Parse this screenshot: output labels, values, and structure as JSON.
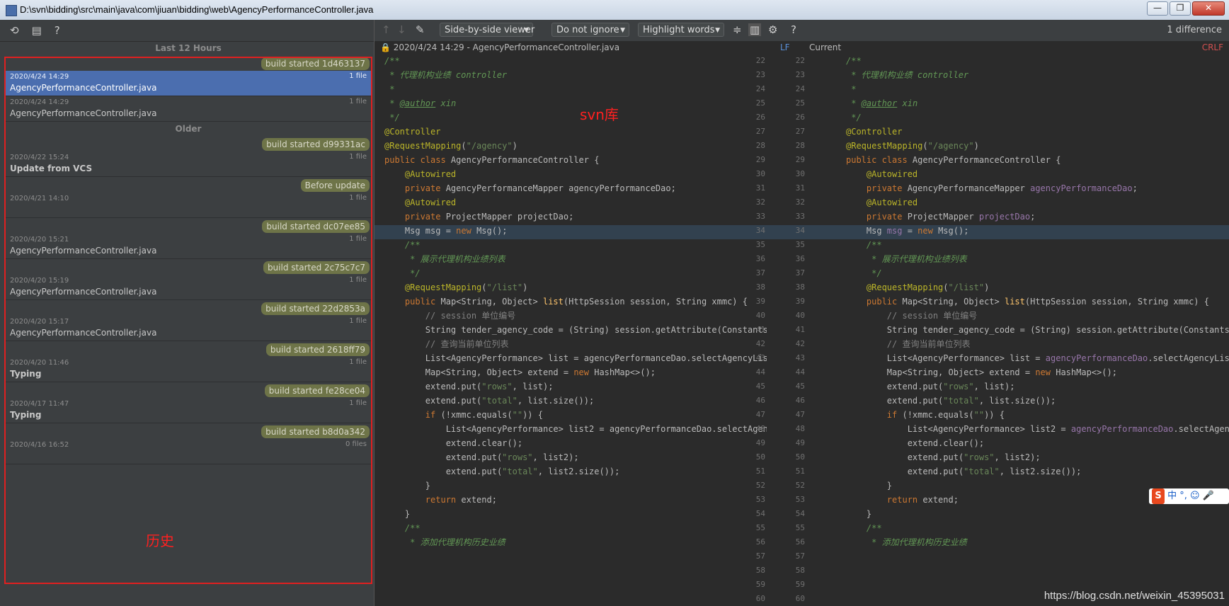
{
  "window": {
    "title": "D:\\svn\\bidding\\src\\main\\java\\com\\jiuan\\bidding\\web\\AgencyPerformanceController.java",
    "buttons": [
      "—",
      "❐",
      "✕"
    ]
  },
  "history": {
    "toolbar_icons": [
      "undo-icon",
      "revision-icon",
      "help-icon"
    ],
    "groups": [
      {
        "label": "Last 12 Hours"
      },
      {
        "label": "Older"
      }
    ],
    "rows": [
      {
        "kind": "group",
        "label": "Last 12 Hours"
      },
      {
        "kind": "tag",
        "label": "build started 1d463137"
      },
      {
        "kind": "item",
        "date": "2020/4/24 14:29",
        "count": "1 file",
        "text": "AgencyPerformanceController.java",
        "selected": true
      },
      {
        "kind": "item",
        "date": "2020/4/24 14:29",
        "count": "1 file",
        "text": "AgencyPerformanceController.java"
      },
      {
        "kind": "group",
        "label": "Older"
      },
      {
        "kind": "tag",
        "label": "build started d99331ac"
      },
      {
        "kind": "item",
        "date": "2020/4/22 15:24",
        "count": "1 file",
        "text": "Update from VCS",
        "bold": true
      },
      {
        "kind": "tag",
        "label": "Before update"
      },
      {
        "kind": "item",
        "date": "2020/4/21 14:10",
        "count": "1 file",
        "text": ""
      },
      {
        "kind": "tag",
        "label": "build started dc07ee85"
      },
      {
        "kind": "item",
        "date": "2020/4/20 15:21",
        "count": "1 file",
        "text": "AgencyPerformanceController.java"
      },
      {
        "kind": "tag",
        "label": "build started 2c75c7c7"
      },
      {
        "kind": "item",
        "date": "2020/4/20 15:19",
        "count": "1 file",
        "text": "AgencyPerformanceController.java"
      },
      {
        "kind": "tag",
        "label": "build started 22d2853a"
      },
      {
        "kind": "item",
        "date": "2020/4/20 15:17",
        "count": "1 file",
        "text": "AgencyPerformanceController.java"
      },
      {
        "kind": "tag",
        "label": "build started 2618ff79"
      },
      {
        "kind": "item",
        "date": "2020/4/20 11:46",
        "count": "1 file",
        "text": "Typing",
        "bold": true
      },
      {
        "kind": "tag",
        "label": "build started fe28ce04"
      },
      {
        "kind": "item",
        "date": "2020/4/17 11:47",
        "count": "1 file",
        "text": "Typing",
        "bold": true
      },
      {
        "kind": "tag",
        "label": "build started b8d0a342"
      },
      {
        "kind": "item",
        "date": "2020/4/16 16:52",
        "count": "0 files",
        "text": ""
      }
    ]
  },
  "annotations": {
    "svn": "svn库",
    "history": "历史"
  },
  "diff": {
    "viewer": "Side-by-side viewer",
    "ignore": "Do not ignore",
    "highlight": "Highlight words",
    "difference_count": "1 difference",
    "left_header": "2020/4/24 14:29 - AgencyPerformanceController.java",
    "left_sep": "LF",
    "right_header": "Current",
    "right_sep": "CRLF",
    "line_start": 22,
    "line_end": 60
  },
  "footer": {
    "watermark": "https://blog.csdn.net/weixin_45395031"
  },
  "ime": {
    "label": "中 °, ☺ 🎤"
  }
}
